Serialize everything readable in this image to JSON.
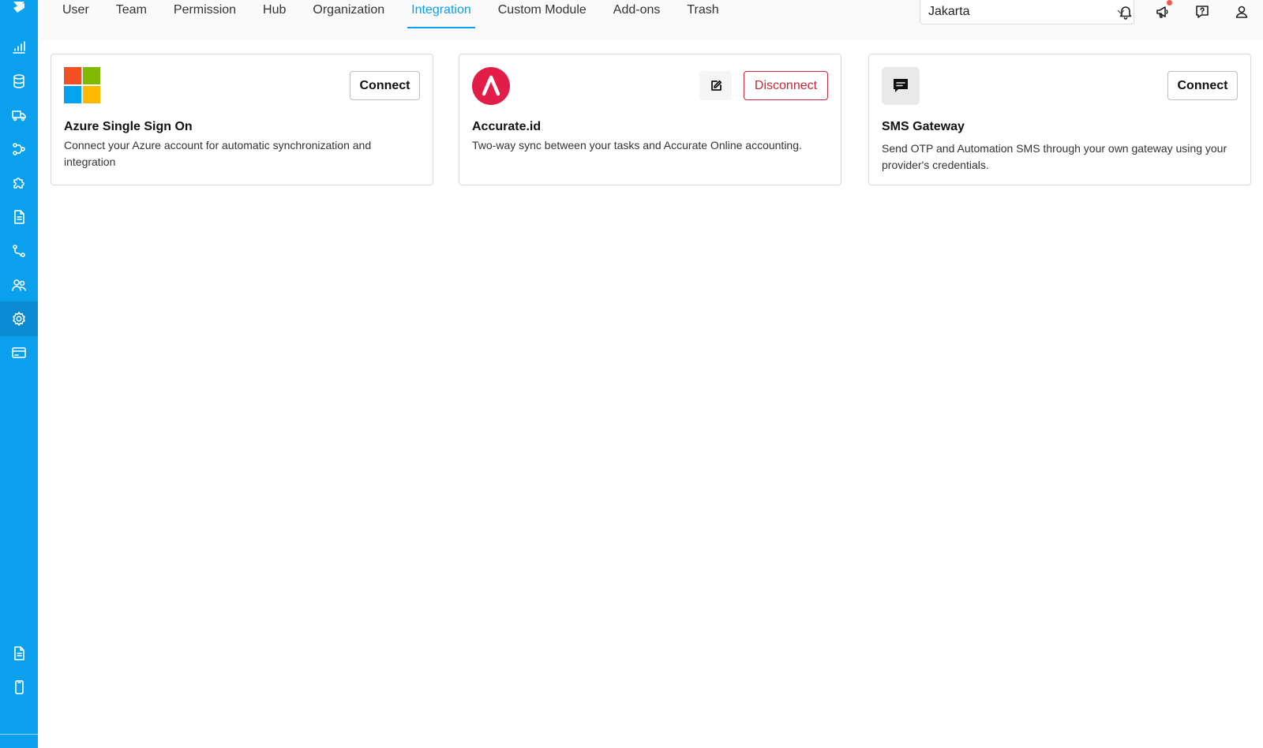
{
  "tabs": [
    {
      "label": "User"
    },
    {
      "label": "Team"
    },
    {
      "label": "Permission"
    },
    {
      "label": "Hub"
    },
    {
      "label": "Organization"
    },
    {
      "label": "Integration"
    },
    {
      "label": "Custom Module"
    },
    {
      "label": "Add-ons"
    },
    {
      "label": "Trash"
    }
  ],
  "active_tab": "Integration",
  "location_select": {
    "value": "Jakarta"
  },
  "sidebar": {
    "icons": [
      "analytics-icon",
      "database-icon",
      "delivery-truck-icon",
      "workflow-icon",
      "puzzle-icon",
      "document-icon",
      "route-icon",
      "users-icon",
      "settings-icon",
      "billing-card-icon",
      "report-icon",
      "mobile-icon"
    ],
    "active": "settings-icon"
  },
  "header_icons": [
    "bell-icon",
    "megaphone-icon",
    "help-icon",
    "user-icon"
  ],
  "cards": [
    {
      "title": "Azure Single Sign On",
      "description": "Connect your Azure account for automatic synchronization and integration",
      "button_label": "Connect"
    },
    {
      "title": "Accurate.id",
      "description": "Two-way sync between your tasks and Accurate Online accounting.",
      "button_label": "Disconnect"
    },
    {
      "title": "SMS Gateway",
      "description": "Send OTP and Automation SMS through your own gateway using your provider's credentials.",
      "button_label": "Connect"
    }
  ],
  "colors": {
    "sidebar": "#0ba0ee",
    "accent": "#0ba0ee",
    "danger": "#c8283a",
    "accurate_brand": "#e11d48"
  }
}
